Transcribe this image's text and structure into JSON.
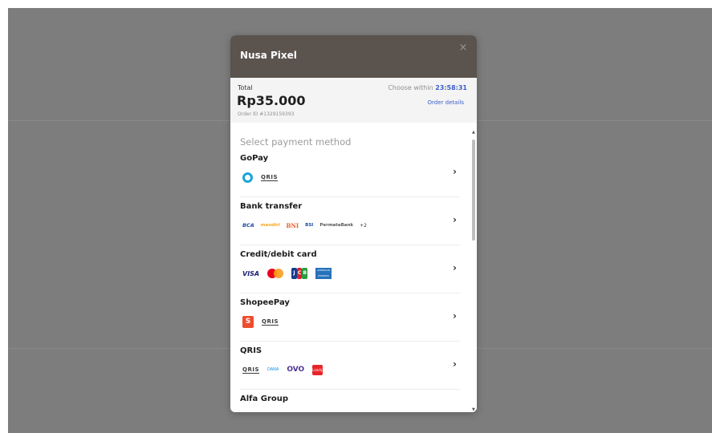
{
  "header": {
    "merchant_name": "Nusa Pixel",
    "close_symbol": "×"
  },
  "summary": {
    "total_label": "Total",
    "amount": "Rp35.000",
    "order_id": "Order ID #1329159393",
    "choose_within_label": "Choose within",
    "countdown": "23:58:31",
    "order_details_label": "Order details"
  },
  "payment": {
    "section_title": "Select payment method",
    "methods": [
      {
        "title": "GoPay",
        "logos": [
          "QRIS"
        ]
      },
      {
        "title": "Bank transfer",
        "logos": [
          "BCA",
          "mandiri",
          "BNI",
          "BSI",
          "PermataBank"
        ],
        "more": "+2"
      },
      {
        "title": "Credit/debit card",
        "logos": [
          "VISA",
          "JCB",
          "AMERICAN EXPRESS"
        ]
      },
      {
        "title": "ShopeePay",
        "logos": [
          "S",
          "QRIS"
        ]
      },
      {
        "title": "QRIS",
        "logos": [
          "QRIS",
          "DANA",
          "OVO",
          "LinkAja"
        ]
      },
      {
        "title": "Alfa Group"
      }
    ]
  },
  "icons": {
    "close": "close-icon",
    "chevron": "chevron-right-icon",
    "gopay": "gopay-icon",
    "mastercard": "mastercard-icon"
  },
  "colors": {
    "header_bg": "#5b534d",
    "accent_blue": "#3a5fc8",
    "backdrop": "#7d7d7d",
    "summary_bg": "#f4f4f4"
  }
}
